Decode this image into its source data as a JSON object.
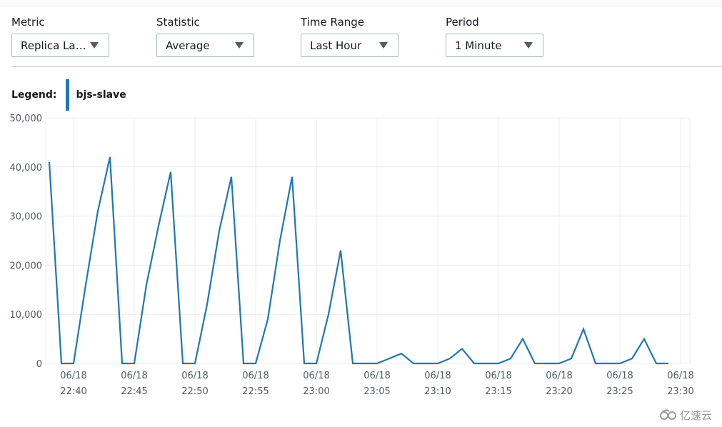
{
  "controls": [
    {
      "label": "Metric",
      "value": "Replica La…"
    },
    {
      "label": "Statistic",
      "value": "Average"
    },
    {
      "label": "Time Range",
      "value": "Last Hour"
    },
    {
      "label": "Period",
      "value": "1 Minute"
    }
  ],
  "legend": {
    "title": "Legend:",
    "series_name": "bjs-slave",
    "color": "#1f77b4"
  },
  "watermark": {
    "icon": "cloud-logo-icon",
    "text": "亿速云"
  },
  "chart_data": {
    "type": "line",
    "title": "",
    "xlabel": "",
    "ylabel": "",
    "ylim": [
      0,
      50000
    ],
    "yticks": [
      0,
      10000,
      20000,
      30000,
      40000,
      50000
    ],
    "ytick_labels": [
      "0",
      "10,000",
      "20,000",
      "30,000",
      "40,000",
      "50,000"
    ],
    "xlim_minutes_from_2240": [
      -2.3,
      50.6
    ],
    "xticks_minutes_from_2240": [
      0,
      5,
      10,
      15,
      20,
      25,
      30,
      35,
      40,
      45,
      50
    ],
    "xtick_labels": [
      [
        "06/18",
        "22:40"
      ],
      [
        "06/18",
        "22:45"
      ],
      [
        "06/18",
        "22:50"
      ],
      [
        "06/18",
        "22:55"
      ],
      [
        "06/18",
        "23:00"
      ],
      [
        "06/18",
        "23:05"
      ],
      [
        "06/18",
        "23:10"
      ],
      [
        "06/18",
        "23:15"
      ],
      [
        "06/18",
        "23:20"
      ],
      [
        "06/18",
        "23:25"
      ],
      [
        "06/18",
        "23:30"
      ]
    ],
    "grid": true,
    "legend_position": "top-left",
    "series": [
      {
        "name": "bjs-slave",
        "color": "#1f77b4",
        "x_minutes_from_2240": [
          -2,
          -1,
          0,
          1,
          2,
          3,
          4,
          5,
          6,
          7,
          8,
          9,
          10,
          11,
          12,
          13,
          14,
          15,
          16,
          17,
          18,
          19,
          20,
          21,
          22,
          23,
          24,
          25,
          26,
          27,
          28,
          29,
          30,
          31,
          32,
          33,
          34,
          35,
          36,
          37,
          38,
          39,
          40,
          41,
          42,
          43,
          44,
          45,
          46,
          47,
          48,
          49
        ],
        "values": [
          41000,
          0,
          0,
          16000,
          31000,
          42000,
          0,
          0,
          16000,
          28000,
          39000,
          0,
          0,
          12000,
          27000,
          38000,
          0,
          0,
          9000,
          25000,
          38000,
          0,
          0,
          10000,
          23000,
          0,
          0,
          0,
          1000,
          2000,
          0,
          0,
          0,
          1000,
          3000,
          0,
          0,
          0,
          1000,
          5000,
          0,
          0,
          0,
          1000,
          7000,
          0,
          0,
          0,
          1000,
          5000,
          0,
          0
        ]
      }
    ]
  }
}
